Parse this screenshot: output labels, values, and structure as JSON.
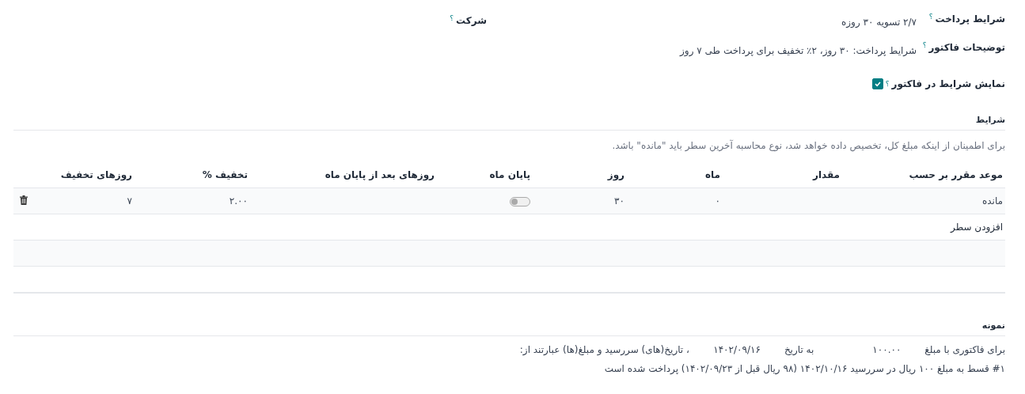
{
  "fields": [
    {
      "label": "شرایط پرداخت",
      "help": "؟",
      "value": "۲/۷ تسویه ۳۰ روزه"
    },
    {
      "label": "توضیحات فاکتور",
      "help": "؟",
      "value": "شرایط پرداخت: ۳۰ روز، ۲٪ تخفیف برای پرداخت طی ۷ روز"
    }
  ],
  "company": {
    "label": "شرکت",
    "help": "؟"
  },
  "show_on_invoice": {
    "label": "نمایش شرایط در فاکتور",
    "help": "؟",
    "checked": true
  },
  "terms": {
    "title": "شرایط",
    "note": "برای اطمینان از اینکه مبلغ کل، تخصیص داده خواهد شد، نوع محاسبه آخرین سطر باید \"مانده\" باشد.",
    "columns": [
      "موعد مقرر بر حسب",
      "مقدار",
      "ماه",
      "روز",
      "پایان ماه",
      "روزهای بعد از پایان ماه",
      "تخفیف %",
      "روزهای تخفیف"
    ],
    "rows": [
      {
        "value_type": "مانده",
        "months": "۰",
        "days": "۳۰",
        "end_of_month": false,
        "discount": "۲.۰۰",
        "discount_days": "۷"
      }
    ],
    "add_line": "افزودن سطر"
  },
  "example": {
    "title": "نمونه",
    "intro": "برای فاکتوری با مبلغ",
    "amount": "۱۰۰.۰۰",
    "date_prefix": "به تاریخ",
    "date": "۱۴۰۲/۰۹/۱۶",
    "suffix": "، تاریخ(های) سررسید و مبلغ(ها) عبارتند از:",
    "lines": [
      "#۱ قسط به مبلغ ۱۰۰ ریال در سررسید ۱۴۰۲/۱۰/۱۶ (۹۸ ریال قبل از ۱۴۰۲/۰۹/۲۳) پرداخت شده است"
    ]
  }
}
